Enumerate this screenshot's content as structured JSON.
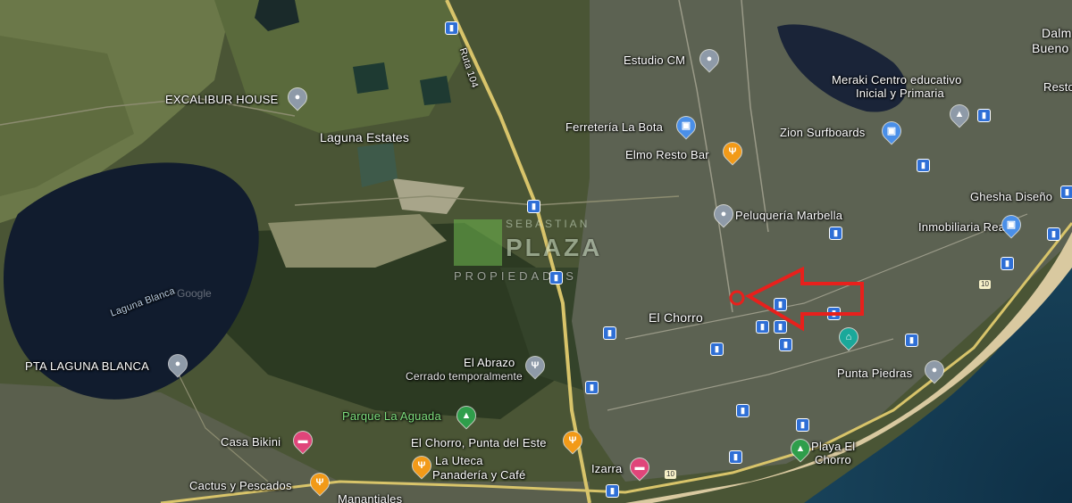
{
  "map": {
    "google_mark": "Google",
    "watermark": {
      "brand_top": "SEBASTIAN",
      "brand_main": "PLAZA",
      "brand_sub": "PROPIEDADES"
    },
    "places": {
      "excalibur": "EXCALIBUR HOUSE",
      "laguna_estates": "Laguna Estates",
      "estudio_cm": "Estudio CM",
      "ferreteria": "Ferretería La Bota",
      "elmo": "Elmo Resto Bar",
      "meraki": "Meraki Centro educativo",
      "meraki2": "Inicial y Primaria",
      "zion": "Zion Surfboards",
      "peluqueria": "Peluquería Marbella",
      "ghesha": "Ghesha Diseño",
      "inmobiliaria": "Inmobiliaria Real",
      "laguna_blanca": "Laguna Blanca",
      "pta_laguna": "PTA LAGUNA BLANCA",
      "el_chorro": "El Chorro",
      "el_abrazo": "El Abrazo",
      "el_abrazo_status": "Cerrado temporalmente",
      "parque": "Parque La Aguada",
      "punta_piedras": "Punta Piedras",
      "casa_bikini": "Casa Bikini",
      "el_chorro_pde": "El Chorro, Punta del Este",
      "la_uteca": "La Uteca",
      "la_uteca2": "Panadería y Café",
      "izarra": "Izarra",
      "playa": "Playa El",
      "playa2": "Chorro",
      "cactus": "Cactus y Pescados",
      "manantiales": "Manantiales",
      "dalmar": "Dalm",
      "dalmar2": "Bueno",
      "resto": "Resto",
      "ruta": "Ruta 104"
    },
    "route_badge": "10",
    "colors": {
      "marker": "#e8201c",
      "pin_blue": "#4a8fe8",
      "pin_orange": "#f29a18",
      "pin_pink": "#e0457a",
      "pin_gray": "#8e9aa8",
      "pin_green": "#2f9e4b",
      "pin_teal": "#1aa89a",
      "bus": "#2f6fd6"
    }
  }
}
